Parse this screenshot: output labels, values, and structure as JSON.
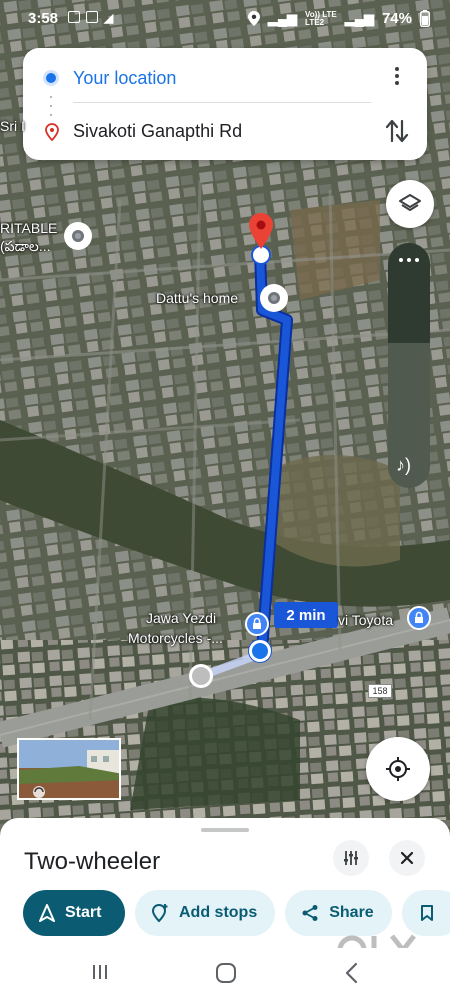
{
  "status_bar": {
    "time": "3:58",
    "network_line1": "Vo)) LTE",
    "network_line2": "LTE2",
    "battery": "74%"
  },
  "directions": {
    "origin": "Your location",
    "destination": "Sivakoti Ganapthi Rd"
  },
  "map": {
    "labels": {
      "top_left_partial": "Sri I",
      "poi_left_line1": "RITABLE",
      "poi_left_line2": "(పడాల...",
      "dattus_home": "Dattu's home",
      "jawa_line1": "Jawa Yezdi",
      "jawa_line2": "Motorcycles -...",
      "toyota": "vi Toyota"
    },
    "route_time": "2 min",
    "road_number": "158",
    "colors": {
      "route": "#1a57d8",
      "destination_pin": "#ea4335"
    }
  },
  "bottom_sheet": {
    "mode_title": "Two-wheeler",
    "buttons": {
      "start": "Start",
      "add_stops": "Add stops",
      "share": "Share"
    }
  },
  "watermark": "OLX",
  "icons": [
    "location-icon",
    "more-vert-icon",
    "swap-icon",
    "layers-icon",
    "volume-icon",
    "my-location-icon",
    "filter-icon",
    "close-icon",
    "navigation-icon",
    "add-location-icon",
    "share-icon",
    "bookmark-icon",
    "recents-icon",
    "home-icon",
    "back-icon"
  ]
}
